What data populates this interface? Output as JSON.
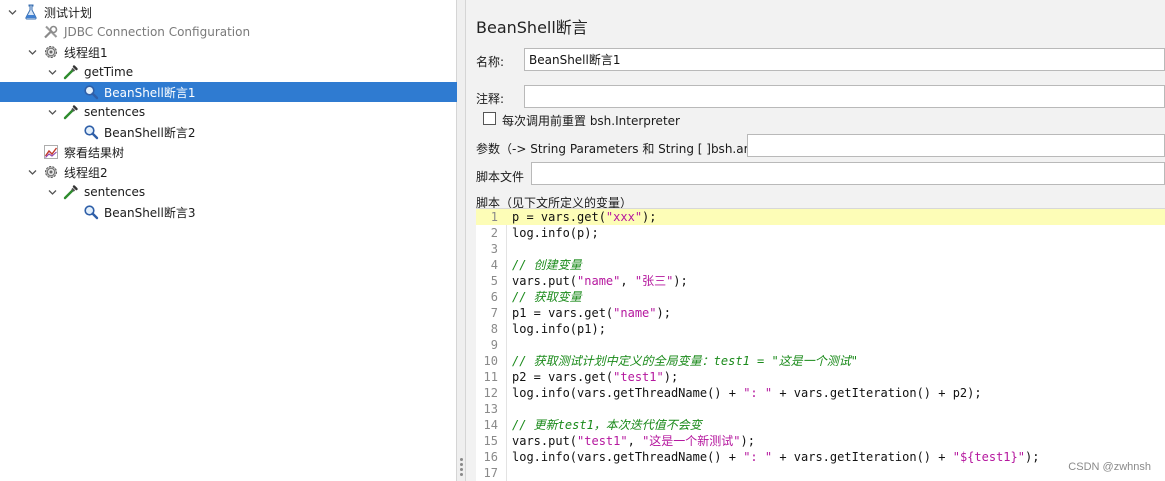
{
  "tree": {
    "items": [
      {
        "label": "测试计划",
        "icon": "flask-icon",
        "toggle": "open",
        "level": 0,
        "selected": false
      },
      {
        "label": "JDBC Connection Configuration",
        "icon": "wrench-icon",
        "toggle": "none",
        "level": 1,
        "selected": false,
        "muted": true
      },
      {
        "label": "线程组1",
        "icon": "gear-icon",
        "toggle": "open",
        "level": 1,
        "selected": false
      },
      {
        "label": "getTime",
        "icon": "pipette-icon",
        "toggle": "open",
        "level": 2,
        "selected": false
      },
      {
        "label": "BeanShell断言1",
        "icon": "magnifier-icon",
        "toggle": "none",
        "level": 3,
        "selected": true
      },
      {
        "label": "sentences",
        "icon": "pipette-icon",
        "toggle": "open",
        "level": 2,
        "selected": false
      },
      {
        "label": "BeanShell断言2",
        "icon": "magnifier-icon",
        "toggle": "none",
        "level": 3,
        "selected": false
      },
      {
        "label": "察看结果树",
        "icon": "chart-icon",
        "toggle": "none",
        "level": 1,
        "selected": false
      },
      {
        "label": "线程组2",
        "icon": "gear-icon",
        "toggle": "open",
        "level": 1,
        "selected": false
      },
      {
        "label": "sentences",
        "icon": "pipette-icon",
        "toggle": "open",
        "level": 2,
        "selected": false
      },
      {
        "label": "BeanShell断言3",
        "icon": "magnifier-icon",
        "toggle": "none",
        "level": 3,
        "selected": false
      }
    ]
  },
  "panel": {
    "title": "BeanShell断言",
    "name_label": "名称:",
    "name_value": "BeanShell断言1",
    "comment_label": "注释:",
    "comment_value": "",
    "reset_checkbox_label": "每次调用前重置 bsh.Interpreter",
    "reset_checked": false,
    "params_label": "参数（-> String Parameters 和 String [ ]bsh.args)",
    "params_value": "",
    "script_file_label": "脚本文件",
    "script_file_value": "",
    "script_label": "脚本（见下文所定义的变量）"
  },
  "editor": {
    "current_line": 1,
    "lines": [
      [
        {
          "t": "p = vars.get(",
          "k": "plain"
        },
        {
          "t": "\"xxx\"",
          "k": "str"
        },
        {
          "t": ");",
          "k": "plain"
        }
      ],
      [
        {
          "t": "log.info(p);",
          "k": "plain"
        }
      ],
      [],
      [
        {
          "t": "// 创建变量",
          "k": "com"
        }
      ],
      [
        {
          "t": "vars.put(",
          "k": "plain"
        },
        {
          "t": "\"name\"",
          "k": "str"
        },
        {
          "t": ", ",
          "k": "plain"
        },
        {
          "t": "\"张三\"",
          "k": "str"
        },
        {
          "t": ");",
          "k": "plain"
        }
      ],
      [
        {
          "t": "// 获取变量",
          "k": "com"
        }
      ],
      [
        {
          "t": "p1 = vars.get(",
          "k": "plain"
        },
        {
          "t": "\"name\"",
          "k": "str"
        },
        {
          "t": ");",
          "k": "plain"
        }
      ],
      [
        {
          "t": "log.info(p1);",
          "k": "plain"
        }
      ],
      [],
      [
        {
          "t": "// 获取测试计划中定义的全局变量：test1 = \"这是一个测试\"",
          "k": "com"
        }
      ],
      [
        {
          "t": "p2 = vars.get(",
          "k": "plain"
        },
        {
          "t": "\"test1\"",
          "k": "str"
        },
        {
          "t": ");",
          "k": "plain"
        }
      ],
      [
        {
          "t": "log.info(vars.getThreadName() + ",
          "k": "plain"
        },
        {
          "t": "\": \"",
          "k": "str"
        },
        {
          "t": " + vars.getIteration() + p2);",
          "k": "plain"
        }
      ],
      [],
      [
        {
          "t": "// 更新test1，本次迭代值不会变",
          "k": "com"
        }
      ],
      [
        {
          "t": "vars.put(",
          "k": "plain"
        },
        {
          "t": "\"test1\"",
          "k": "str"
        },
        {
          "t": ", ",
          "k": "plain"
        },
        {
          "t": "\"这是一个新测试\"",
          "k": "str"
        },
        {
          "t": ");",
          "k": "plain"
        }
      ],
      [
        {
          "t": "log.info(vars.getThreadName() + ",
          "k": "plain"
        },
        {
          "t": "\": \"",
          "k": "str"
        },
        {
          "t": " + vars.getIteration() + ",
          "k": "plain"
        },
        {
          "t": "\"${test1}\"",
          "k": "str"
        },
        {
          "t": ");",
          "k": "plain"
        }
      ],
      []
    ]
  },
  "watermark": "CSDN @zwhnsh",
  "colors": {
    "selection": "#2f7bd1",
    "current_line": "#fdfdb7",
    "string": "#b5179e",
    "comment": "#1a8a1a"
  }
}
